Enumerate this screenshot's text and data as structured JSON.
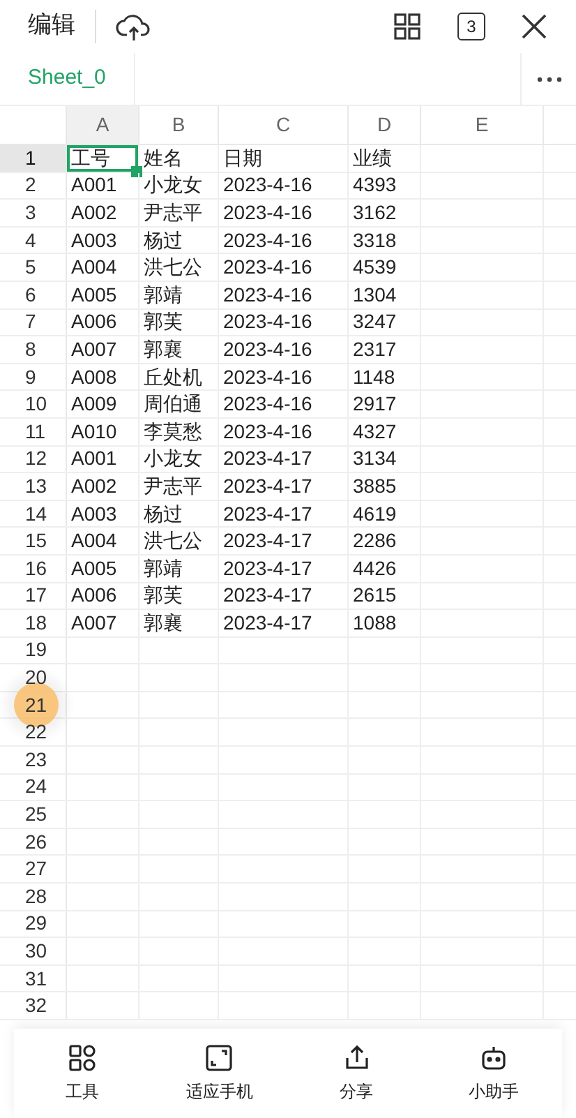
{
  "toolbar": {
    "edit_label": "编辑",
    "window_count": "3"
  },
  "sheet_tabs": [
    {
      "label": "Sheet_0",
      "selected": true
    }
  ],
  "columns": [
    {
      "label": "A",
      "selected": true
    },
    {
      "label": "B",
      "selected": false
    },
    {
      "label": "C",
      "selected": false
    },
    {
      "label": "D",
      "selected": false
    },
    {
      "label": "E",
      "selected": false
    }
  ],
  "rows": [
    {
      "number": "1",
      "selected": true,
      "cells": [
        "工号",
        "姓名",
        "日期",
        "业绩"
      ]
    },
    {
      "number": "2",
      "selected": false,
      "cells": [
        "A001",
        "小龙女",
        "2023-4-16",
        "4393"
      ]
    },
    {
      "number": "3",
      "selected": false,
      "cells": [
        "A002",
        "尹志平",
        "2023-4-16",
        "3162"
      ]
    },
    {
      "number": "4",
      "selected": false,
      "cells": [
        "A003",
        "杨过",
        "2023-4-16",
        "3318"
      ]
    },
    {
      "number": "5",
      "selected": false,
      "cells": [
        "A004",
        "洪七公",
        "2023-4-16",
        "4539"
      ]
    },
    {
      "number": "6",
      "selected": false,
      "cells": [
        "A005",
        "郭靖",
        "2023-4-16",
        "1304"
      ]
    },
    {
      "number": "7",
      "selected": false,
      "cells": [
        "A006",
        "郭芙",
        "2023-4-16",
        "3247"
      ]
    },
    {
      "number": "8",
      "selected": false,
      "cells": [
        "A007",
        "郭襄",
        "2023-4-16",
        "2317"
      ]
    },
    {
      "number": "9",
      "selected": false,
      "cells": [
        "A008",
        "丘处机",
        "2023-4-16",
        "1148"
      ]
    },
    {
      "number": "10",
      "selected": false,
      "cells": [
        "A009",
        "周伯通",
        "2023-4-16",
        "2917"
      ]
    },
    {
      "number": "11",
      "selected": false,
      "cells": [
        "A010",
        "李莫愁",
        "2023-4-16",
        "4327"
      ]
    },
    {
      "number": "12",
      "selected": false,
      "cells": [
        "A001",
        "小龙女",
        "2023-4-17",
        "3134"
      ]
    },
    {
      "number": "13",
      "selected": false,
      "cells": [
        "A002",
        "尹志平",
        "2023-4-17",
        "3885"
      ]
    },
    {
      "number": "14",
      "selected": false,
      "cells": [
        "A003",
        "杨过",
        "2023-4-17",
        "4619"
      ]
    },
    {
      "number": "15",
      "selected": false,
      "cells": [
        "A004",
        "洪七公",
        "2023-4-17",
        "2286"
      ]
    },
    {
      "number": "16",
      "selected": false,
      "cells": [
        "A005",
        "郭靖",
        "2023-4-17",
        "4426"
      ]
    },
    {
      "number": "17",
      "selected": false,
      "cells": [
        "A006",
        "郭芙",
        "2023-4-17",
        "2615"
      ]
    },
    {
      "number": "18",
      "selected": false,
      "cells": [
        "A007",
        "郭襄",
        "2023-4-17",
        "1088"
      ]
    },
    {
      "number": "19",
      "selected": false
    },
    {
      "number": "20",
      "selected": false
    },
    {
      "number": "21",
      "selected": false
    },
    {
      "number": "22",
      "selected": false
    },
    {
      "number": "23",
      "selected": false
    },
    {
      "number": "24",
      "selected": false
    },
    {
      "number": "25",
      "selected": false
    },
    {
      "number": "26",
      "selected": false
    },
    {
      "number": "27",
      "selected": false
    },
    {
      "number": "28",
      "selected": false
    },
    {
      "number": "29",
      "selected": false
    },
    {
      "number": "30",
      "selected": false
    },
    {
      "number": "31",
      "selected": false
    },
    {
      "number": "32",
      "selected": false
    }
  ],
  "bottom_bar": [
    {
      "kind": "tools",
      "label": "工具"
    },
    {
      "kind": "fit",
      "label": "适应手机"
    },
    {
      "kind": "share",
      "label": "分享"
    },
    {
      "kind": "assistant",
      "label": "小助手"
    }
  ]
}
